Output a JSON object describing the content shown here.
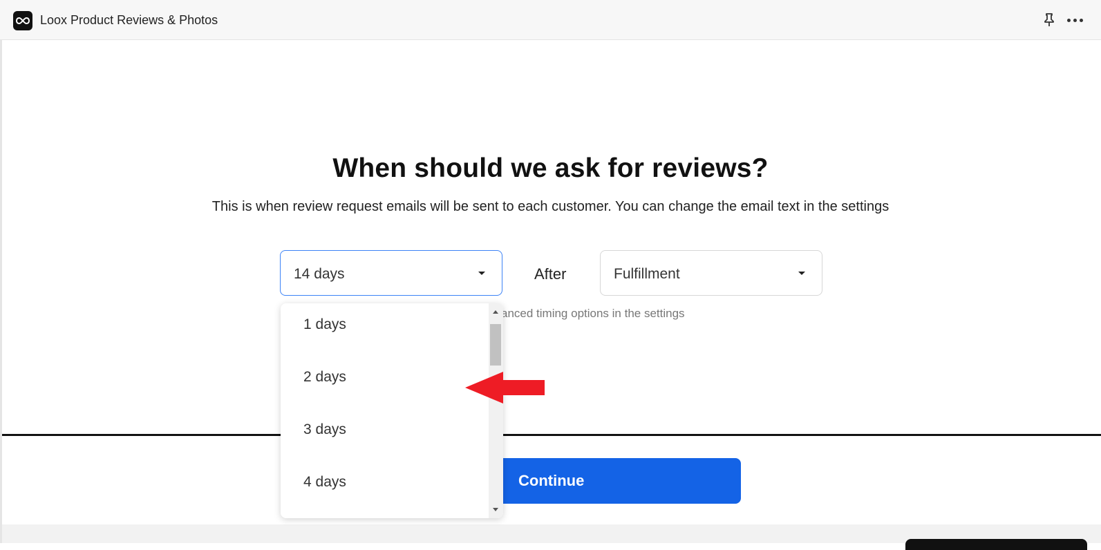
{
  "app": {
    "title": "Loox Product Reviews & Photos",
    "accent_color": "#1463e6"
  },
  "header_icons": [
    "infinity-logo-icon",
    "pin-icon",
    "more-icon"
  ],
  "main": {
    "heading": "When should we ask for reviews?",
    "subheading": "This is when review request emails will be sent to each customer. You can change the email text in the settings",
    "delay_select": {
      "value": "14 days"
    },
    "after_label": "After",
    "event_select": {
      "value": "Fulfillment"
    },
    "hint_visible": "anced timing options in the settings"
  },
  "dropdown": {
    "options": [
      "1 days",
      "2 days",
      "3 days",
      "4 days"
    ]
  },
  "footer": {
    "continue_label": "Continue"
  },
  "annotation": {
    "arrow_color": "#ee1c25",
    "points_to": "2 days"
  }
}
